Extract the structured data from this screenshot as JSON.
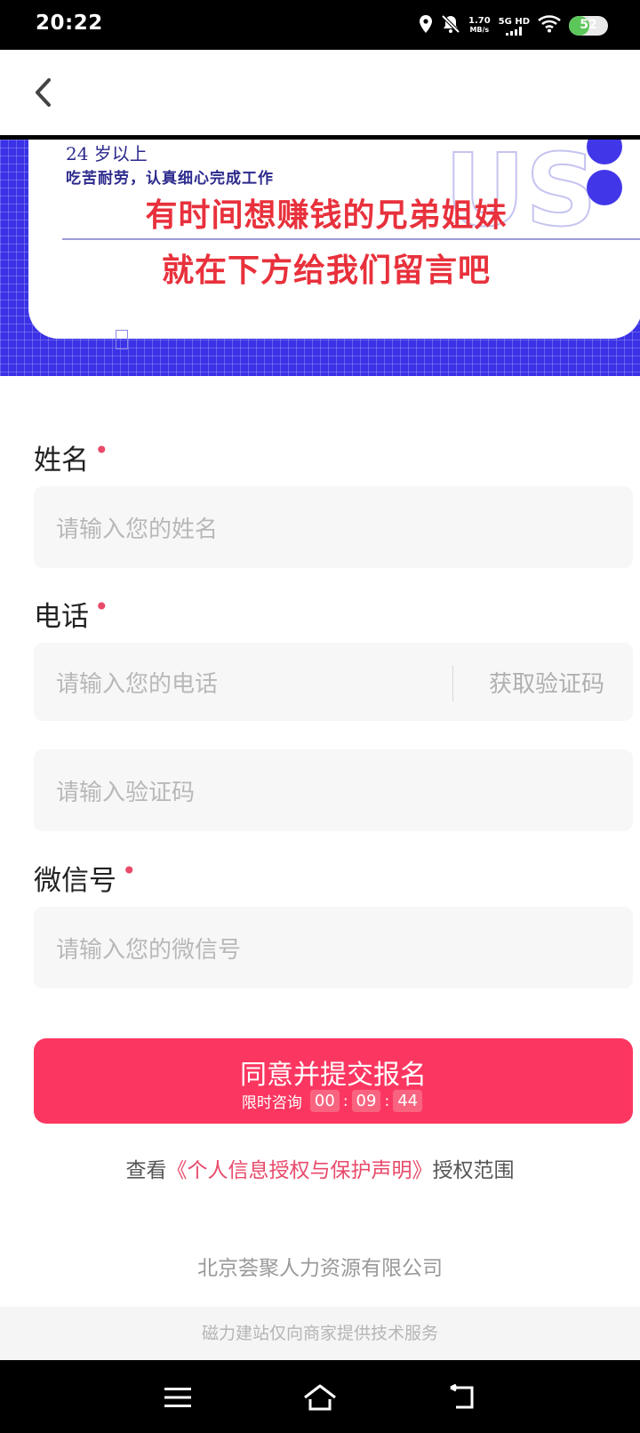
{
  "status_bar": {
    "time": "20:22",
    "speed_value": "1.70",
    "speed_unit": "MB/s",
    "network": "5G HD",
    "battery": "52"
  },
  "banner": {
    "age_text": "24 岁以上",
    "desc_text": "吃苦耐劳，认真细心完成工作",
    "deco_text": "US",
    "headline1": "有时间想赚钱的兄弟姐妹",
    "headline2": "就在下方给我们留言吧"
  },
  "form": {
    "name": {
      "label": "姓名",
      "required": "•",
      "placeholder": "请输入您的姓名"
    },
    "phone": {
      "label": "电话",
      "required": "•",
      "placeholder": "请输入您的电话",
      "get_code": "获取验证码"
    },
    "code": {
      "placeholder": "请输入验证码"
    },
    "wechat": {
      "label": "微信号",
      "required": "•",
      "placeholder": "请输入您的微信号"
    }
  },
  "submit": {
    "label": "同意并提交报名",
    "timer_label": "限时咨询",
    "hours": "00",
    "minutes": "09",
    "seconds": "44"
  },
  "policy": {
    "prefix": "查看",
    "link": "《个人信息授权与保护声明》",
    "suffix": "授权范围"
  },
  "company": "北京荟聚人力资源有限公司",
  "footer": "磁力建站仅向商家提供技术服务",
  "colors": {
    "accent": "#fb3761",
    "banner_blue": "#3b32e6",
    "headline_red": "#e8313c"
  }
}
